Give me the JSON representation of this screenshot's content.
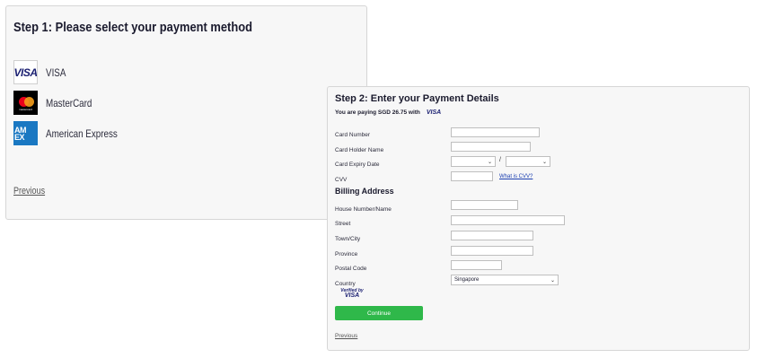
{
  "step1": {
    "title": "Step 1: Please select your payment method",
    "methods": [
      {
        "label": "VISA",
        "logo_text": "VISA",
        "icon": "visa-logo"
      },
      {
        "label": "MasterCard",
        "logo_text": "mastercard",
        "icon": "mastercard-logo"
      },
      {
        "label": "American Express",
        "logo_text": "AM EX",
        "icon": "amex-logo"
      }
    ],
    "previous": "Previous"
  },
  "step2": {
    "title": "Step 2: Enter your Payment Details",
    "paying_text": "You are paying SGD 26.75 with",
    "paying_card": "VISA",
    "labels": {
      "card_number": "Card Number",
      "card_holder": "Card Holder Name",
      "expiry": "Card Expiry Date",
      "cvv": "CVV",
      "cvv_link": "What is CVV?",
      "billing_title": "Billing Address",
      "house": "House Number/Name",
      "street": "Street",
      "town": "Town/City",
      "province": "Province",
      "postal": "Postal Code",
      "country": "Country"
    },
    "values": {
      "card_number": "",
      "card_holder": "",
      "expiry_month": "",
      "expiry_year": "",
      "expiry_separator": "/",
      "cvv": "",
      "house": "",
      "street": "",
      "town": "",
      "province": "",
      "postal": "",
      "country": "Singapore"
    },
    "verified_line1": "Verified by",
    "verified_line2": "VISA",
    "continue": "Continue",
    "previous": "Previous"
  },
  "colors": {
    "continue_bg": "#2fb84a",
    "link": "#1a3eb0",
    "visa_blue": "#1a1f71",
    "amex_blue": "#1a78c2"
  }
}
